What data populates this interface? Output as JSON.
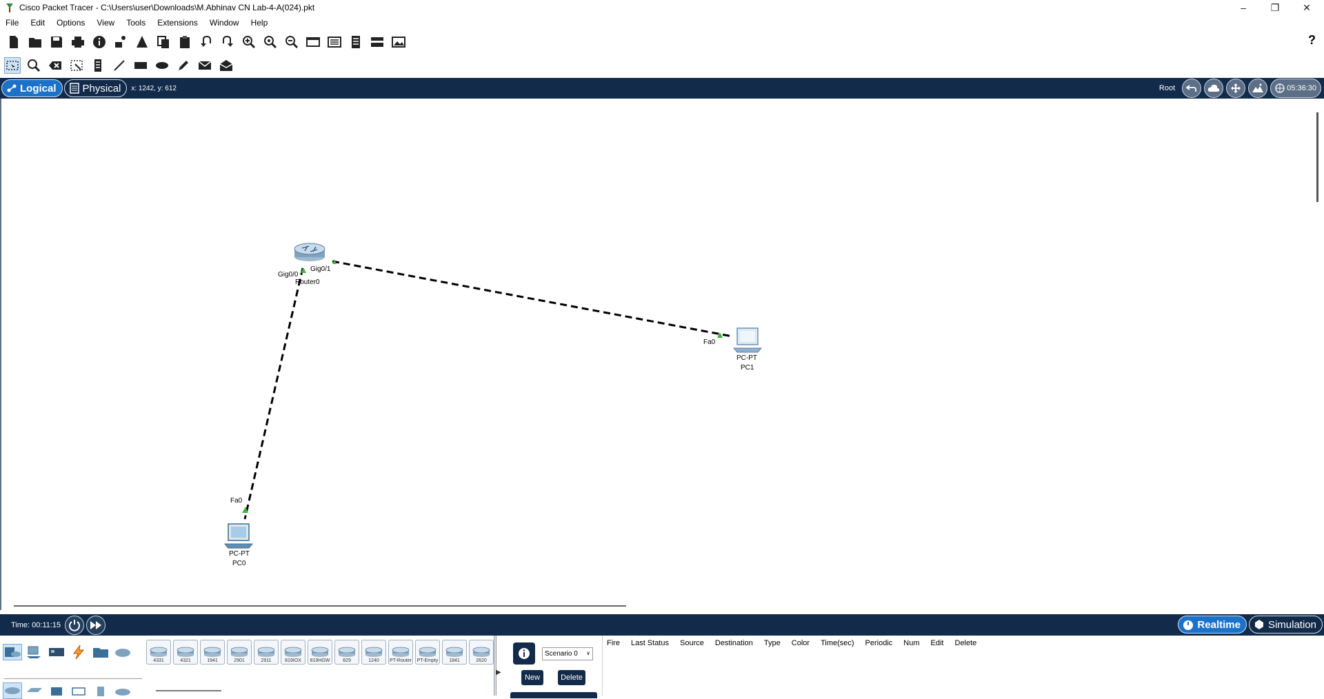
{
  "window": {
    "title": "Cisco Packet Tracer - C:\\Users\\user\\Downloads\\M.Abhinav CN Lab-4-A(024).pkt"
  },
  "menu": [
    "File",
    "Edit",
    "Options",
    "View",
    "Tools",
    "Extensions",
    "Window",
    "Help"
  ],
  "navbar": {
    "logical_label": "Logical",
    "physical_label": "Physical",
    "coords": "x: 1242, y: 612",
    "root_label": "Root",
    "clock": "05:36:30"
  },
  "topology": {
    "devices": [
      {
        "id": "router0",
        "label": "Router0"
      },
      {
        "id": "pc0",
        "type": "PC-PT",
        "label": "PC0"
      },
      {
        "id": "pc1",
        "type": "PC-PT",
        "label": "PC1"
      }
    ],
    "ports": {
      "router_gig00": "Gig0/0",
      "router_gig01": "Gig0/1",
      "pc0_fa0": "Fa0",
      "pc1_fa0": "Fa0"
    }
  },
  "bottombar": {
    "time_label": "Time: 00:11:15",
    "realtime_label": "Realtime",
    "simulation_label": "Simulation"
  },
  "device_models": [
    "4331",
    "4321",
    "1941",
    "2901",
    "2911",
    "819IOX",
    "819HGW",
    "829",
    "1240",
    "PT-Router",
    "PT-Empty",
    "1841",
    "2620"
  ],
  "scenario": {
    "selected": "Scenario 0",
    "new_label": "New",
    "delete_label": "Delete"
  },
  "pdu_columns": [
    "Fire",
    "Last Status",
    "Source",
    "Destination",
    "Type",
    "Color",
    "Time(sec)",
    "Periodic",
    "Num",
    "Edit",
    "Delete"
  ]
}
